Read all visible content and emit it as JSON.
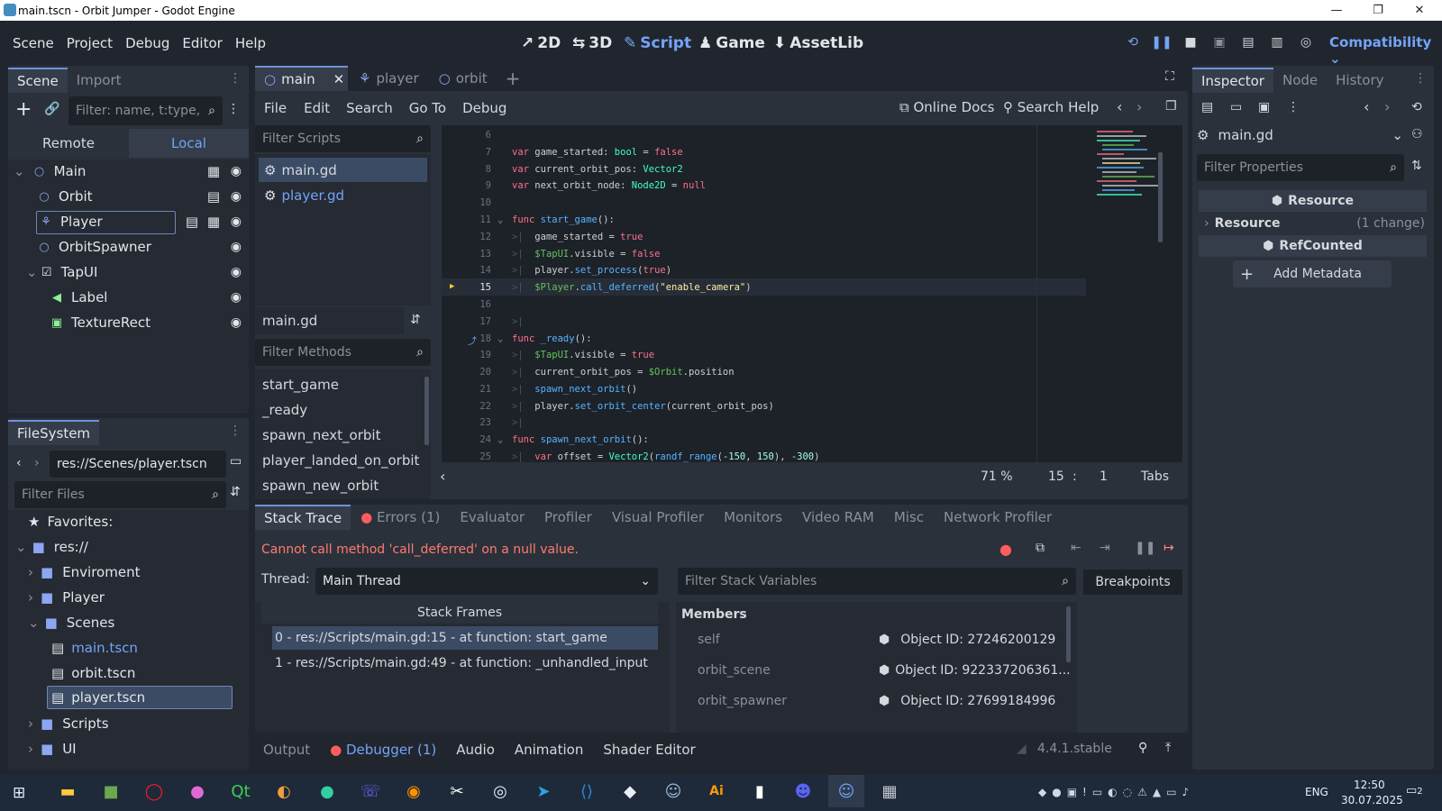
{
  "window": {
    "title": "main.tscn - Orbit Jumper - Godot Engine",
    "min": "—",
    "max": "❐",
    "close": "✕"
  },
  "menu": [
    "Scene",
    "Project",
    "Debug",
    "Editor",
    "Help"
  ],
  "modes": [
    {
      "icon": "↗",
      "label": "2D"
    },
    {
      "icon": "⇆",
      "label": "3D"
    },
    {
      "icon": "✎",
      "label": "Script"
    },
    {
      "icon": "♟",
      "label": "Game"
    },
    {
      "icon": "⬇",
      "label": "AssetLib"
    }
  ],
  "renderer": "Compatibility",
  "scene_dock": {
    "tabs": [
      "Scene",
      "Import"
    ],
    "filter_placeholder": "Filter: name, t:type, g:group",
    "remote": "Remote",
    "local": "Local",
    "nodes": [
      "Main",
      "Orbit",
      "Player",
      "OrbitSpawner",
      "TapUI",
      "Label",
      "TextureRect"
    ]
  },
  "filesystem": {
    "tab": "FileSystem",
    "path": "res://Scenes/player.tscn",
    "filter_placeholder": "Filter Files",
    "favorites": "Favorites:",
    "items": [
      "res://",
      "Enviroment",
      "Player",
      "Scenes",
      "main.tscn",
      "orbit.tscn",
      "player.tscn",
      "Scripts",
      "UI"
    ]
  },
  "editor_tabs": [
    "main",
    "player",
    "orbit"
  ],
  "script_menu": [
    "File",
    "Edit",
    "Search",
    "Go To",
    "Debug"
  ],
  "online_docs": "Online Docs",
  "search_help": "Search Help",
  "scripts": {
    "filter_placeholder": "Filter Scripts",
    "list": [
      "main.gd",
      "player.gd"
    ],
    "current": "main.gd",
    "methods_placeholder": "Filter Methods",
    "methods": [
      "start_game",
      "_ready",
      "spawn_next_orbit",
      "player_landed_on_orbit",
      "spawn_new_orbit"
    ]
  },
  "code": {
    "zoom": "71 %",
    "line": "15",
    "col": "1",
    "indent": "Tabs",
    "line_numbers": [
      "6",
      "7",
      "8",
      "9",
      "10",
      "11",
      "12",
      "13",
      "14",
      "15",
      "16",
      "17",
      "18",
      "19",
      "20",
      "21",
      "22",
      "23",
      "24",
      "25"
    ]
  },
  "debugger": {
    "tabs": [
      "Stack Trace",
      "Errors (1)",
      "Evaluator",
      "Profiler",
      "Visual Profiler",
      "Monitors",
      "Video RAM",
      "Misc",
      "Network Profiler"
    ],
    "error": "Cannot call method 'call_deferred' on a null value.",
    "thread_label": "Thread:",
    "thread": "Main Thread",
    "filter_vars": "Filter Stack Variables",
    "breakpoints": "Breakpoints",
    "frames_header": "Stack Frames",
    "frames": [
      "0 - res://Scripts/main.gd:15 - at function: start_game",
      "1 - res://Scripts/main.gd:49 - at function: _unhandled_input"
    ],
    "members_header": "Members",
    "members": [
      {
        "name": "self",
        "value": "Object ID: 27246200129"
      },
      {
        "name": "orbit_scene",
        "value": "Object ID: 922337206361..."
      },
      {
        "name": "orbit_spawner",
        "value": "Object ID: 27699184996"
      }
    ]
  },
  "bottom": {
    "tabs": [
      "Output",
      "Debugger (1)",
      "Audio",
      "Animation",
      "Shader Editor"
    ],
    "version": "4.4.1.stable"
  },
  "inspector": {
    "tabs": [
      "Inspector",
      "Node",
      "History"
    ],
    "resource": "main.gd",
    "filter_placeholder": "Filter Properties",
    "sec1": "Resource",
    "res_label": "Resource",
    "res_change": "(1 change)",
    "sec2": "RefCounted",
    "add_meta": "Add Metadata"
  },
  "taskbar": {
    "lang": "ENG",
    "time": "12:50",
    "date": "30.07.2025",
    "notif": "2"
  }
}
